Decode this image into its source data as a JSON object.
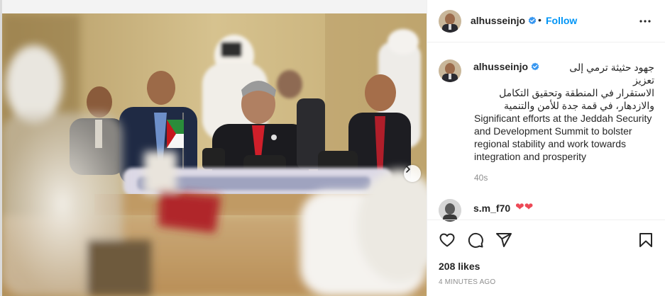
{
  "post": {
    "username": "alhusseinjo",
    "separator": "•",
    "follow_label": "Follow",
    "caption_arabic_line1": "جهود حثيثة ترمي إلى تعزيز",
    "caption_arabic_line2": "الاستقرار في المنطقة وتحقيق التكامل",
    "caption_arabic_line3": "والازدهار، في قمة جدة للأمن والتنمية",
    "caption_english": "Significant efforts at the Jeddah Security and Development Summit to bolster regional stability and work towards integration and prosperity",
    "caption_time": "40s",
    "likes": "208 likes",
    "posted_ago": "4 MINUTES AGO"
  },
  "comment": {
    "username": "s.m_f70",
    "text": "❤❤"
  },
  "carousel": {
    "slide_count": 3,
    "active_slide": 1
  },
  "colors": {
    "accent": "#0095f6",
    "verified": "#3897f0",
    "heart": "#ed4956",
    "secondary_text": "#8e8e8e",
    "border": "#efefef"
  },
  "icons": [
    "verified-badge-icon",
    "more-options-icon",
    "carousel-next-icon",
    "like-heart-icon",
    "comment-icon",
    "share-icon",
    "save-bookmark-icon"
  ]
}
